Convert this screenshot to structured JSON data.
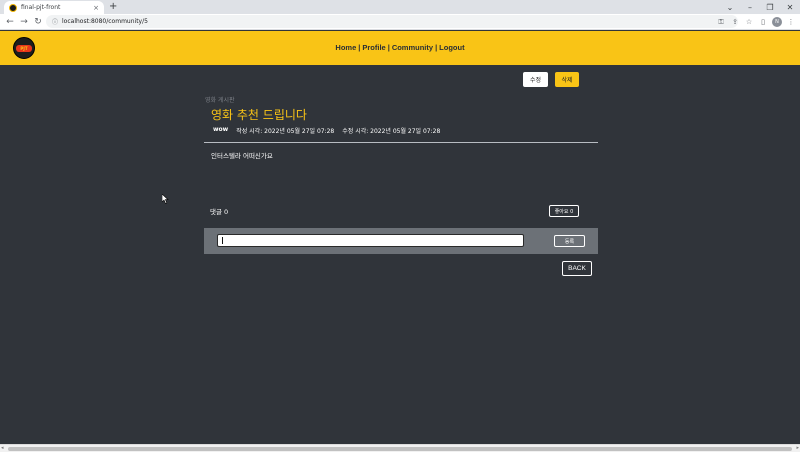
{
  "browser": {
    "tab_title": "final-pjt-front",
    "tab_close": "×",
    "new_tab": "+",
    "url": "localhost:8080/community/5",
    "win_minimize": "–",
    "win_maximize": "❐",
    "win_close": "✕",
    "win_dropdown": "⌄",
    "nav_back": "←",
    "nav_forward": "→",
    "nav_reload": "↻",
    "lock": "ⓘ",
    "key_icon": "⚿",
    "share_icon": "⇪",
    "star_icon": "☆",
    "sidebar_icon": "▯",
    "profile_initial": "N",
    "menu_icon": "⋮"
  },
  "header": {
    "logo_text": "PJT",
    "nav": [
      "Home",
      "Profile",
      "Community",
      "Logout"
    ],
    "separator": "|",
    "brand_color": "#f9c416"
  },
  "post": {
    "edit_label": "수정",
    "delete_label": "삭제",
    "board_label": "영화 게시판",
    "title": "영화 추천 드립니다",
    "author": "wow",
    "created_label": "작성 시각: 2022년 05월 27일 07:28",
    "updated_label": "수정 시각: 2022년 05월 27일 07:28",
    "body": "인터스텔라 어떠신가요"
  },
  "comments": {
    "count_label": "댓글 0",
    "like_label": "좋아요 0",
    "input_value": "",
    "submit_label": "등록"
  },
  "back_label": "BACK",
  "scrollbar": {
    "left": "◂",
    "right": "▸"
  }
}
